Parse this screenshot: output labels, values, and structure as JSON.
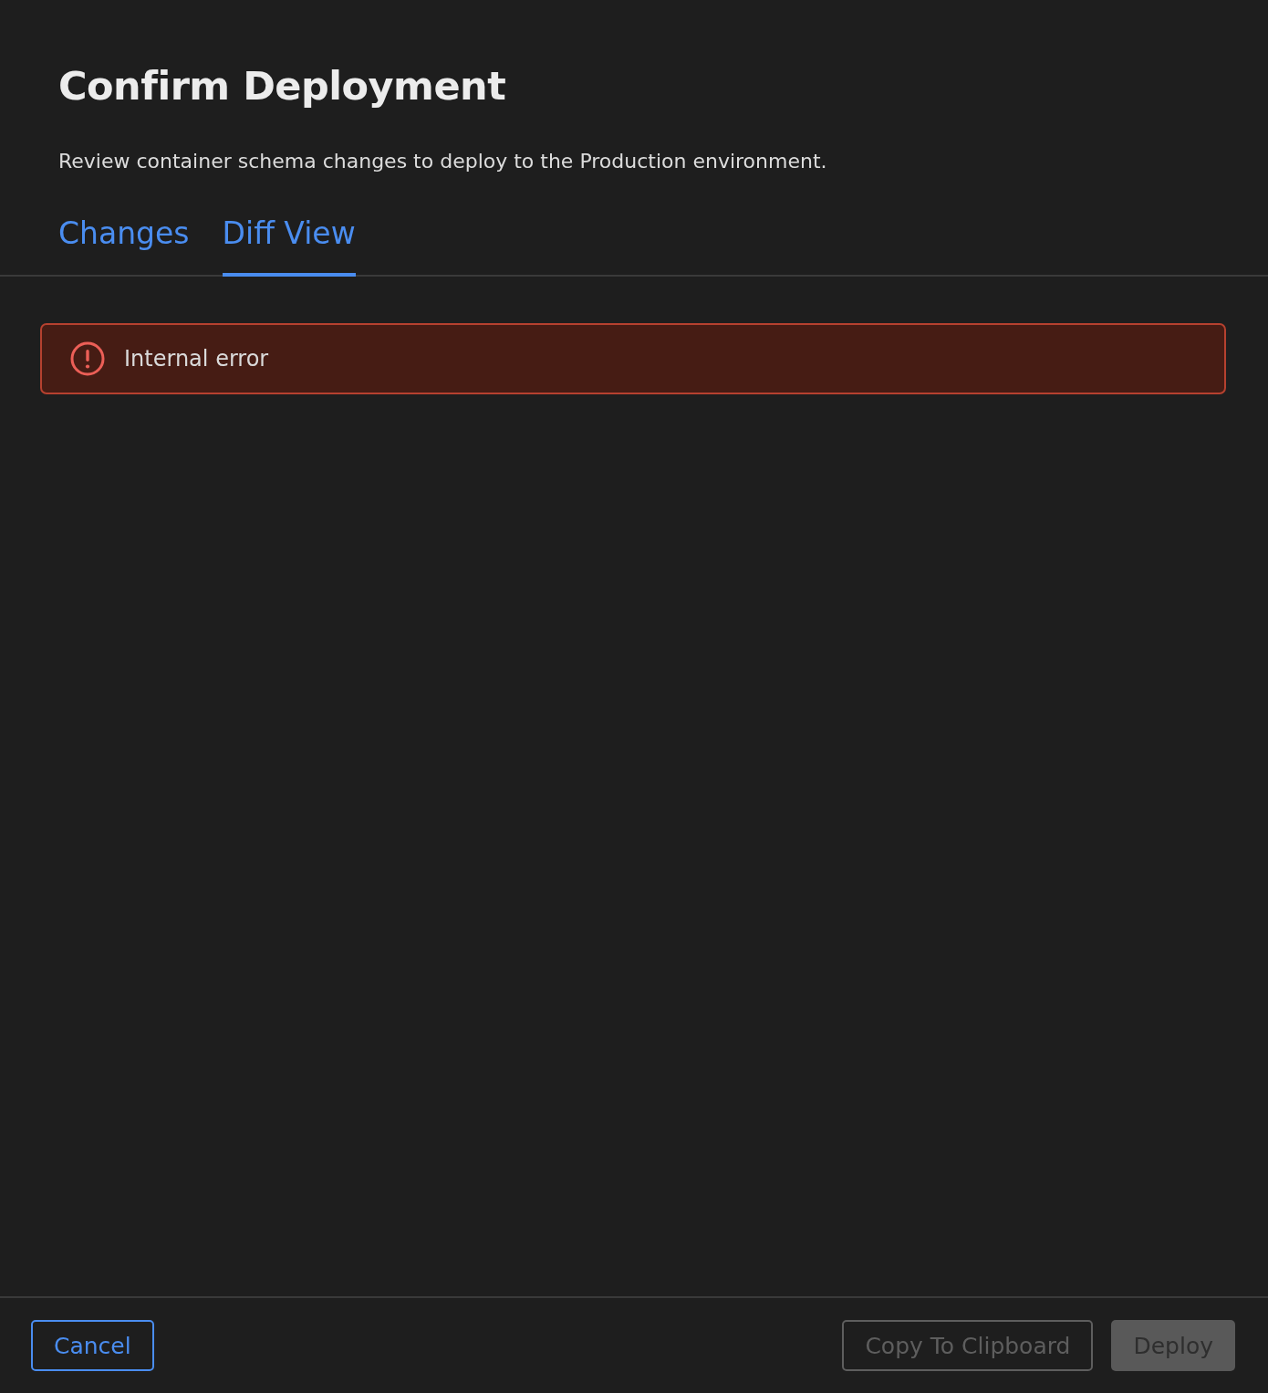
{
  "dialog": {
    "title": "Confirm Deployment",
    "subtitle": "Review container schema changes to deploy to the Production environment."
  },
  "tabs": [
    {
      "label": "Changes",
      "selected": false
    },
    {
      "label": "Diff View",
      "selected": true
    }
  ],
  "alert": {
    "kind": "error",
    "message": "Internal error"
  },
  "footer": {
    "left_buttons": [
      {
        "label": "Cancel",
        "kind": "outline",
        "disabled": false
      }
    ],
    "right_buttons": [
      {
        "label": "Copy To Clipboard",
        "kind": "outline",
        "disabled": true
      },
      {
        "label": "Deploy",
        "kind": "filled",
        "disabled": true
      }
    ]
  }
}
